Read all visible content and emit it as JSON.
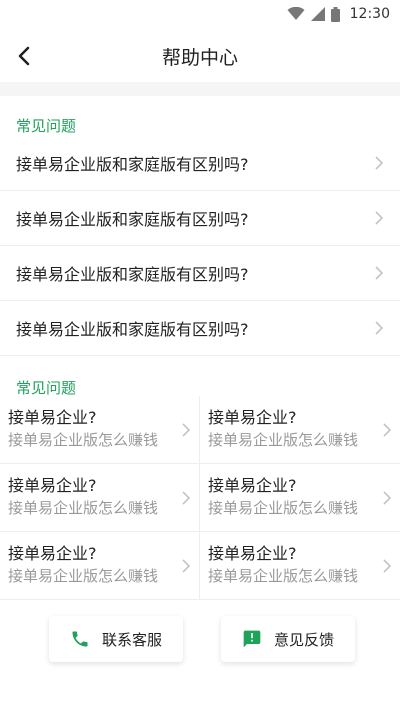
{
  "status_bar": {
    "time": "12:30"
  },
  "nav": {
    "title": "帮助中心"
  },
  "sections": [
    {
      "title": "常见问题"
    },
    {
      "title": "常见问题"
    }
  ],
  "faq": [
    {
      "label": "接单易企业版和家庭版有区别吗?"
    },
    {
      "label": "接单易企业版和家庭版有区别吗?"
    },
    {
      "label": "接单易企业版和家庭版有区别吗?"
    },
    {
      "label": "接单易企业版和家庭版有区别吗?"
    }
  ],
  "grid": [
    {
      "title": "接单易企业?",
      "subtitle": "接单易企业版怎么赚钱"
    },
    {
      "title": "接单易企业?",
      "subtitle": "接单易企业版怎么赚钱"
    },
    {
      "title": "接单易企业?",
      "subtitle": "接单易企业版怎么赚钱"
    },
    {
      "title": "接单易企业?",
      "subtitle": "接单易企业版怎么赚钱"
    },
    {
      "title": "接单易企业?",
      "subtitle": "接单易企业版怎么赚钱"
    },
    {
      "title": "接单易企业?",
      "subtitle": "接单易企业版怎么赚钱"
    }
  ],
  "actions": {
    "contact": {
      "label": "联系客服",
      "icon": "phone-icon"
    },
    "feedback": {
      "label": "意见反馈",
      "icon": "feedback-icon"
    }
  },
  "colors": {
    "accent": "#1fa35a",
    "divider": "#eeeeee",
    "muted": "#9a9a9a",
    "band": "#f5f5f5"
  }
}
